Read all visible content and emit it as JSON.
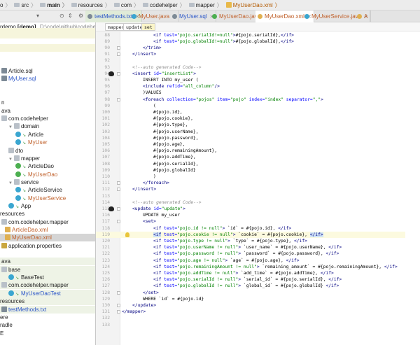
{
  "breadcrumb": [
    "o",
    "src",
    "main",
    "resources",
    "com",
    "codehelper",
    "mapper",
    "MyUserDao.xml"
  ],
  "project": {
    "root_name": "rdemo",
    "root_module": "[demo]",
    "root_path": "D:\\code\\github\\codehelper",
    "tree": [
      {
        "label": "Article.sql",
        "indent": 0,
        "icon": "txt",
        "color": "#222"
      },
      {
        "label": "MyUser.sql",
        "indent": 0,
        "icon": "txt",
        "color": "#2a55c8"
      },
      {
        "label": "",
        "indent": 0
      },
      {
        "label": "",
        "indent": 0
      },
      {
        "label": "n",
        "indent": 0
      },
      {
        "label": "ava",
        "indent": 0
      },
      {
        "label": "com.codehelper",
        "indent": 0,
        "icon": "folder"
      },
      {
        "label": "domain",
        "indent": 1,
        "icon": "folder",
        "arrow": "▼"
      },
      {
        "label": "Article",
        "indent": 2,
        "icon": "cls",
        "mod": true
      },
      {
        "label": "MyUser",
        "indent": 2,
        "icon": "cls",
        "mod": true,
        "color": "#c0602a"
      },
      {
        "label": "dto",
        "indent": 1,
        "icon": "folder"
      },
      {
        "label": "mapper",
        "indent": 1,
        "icon": "folder",
        "arrow": "▼"
      },
      {
        "label": "ArticleDao",
        "indent": 2,
        "icon": "intf",
        "mod": true
      },
      {
        "label": "MyUserDao",
        "indent": 2,
        "icon": "intf",
        "mod": true,
        "color": "#c0602a"
      },
      {
        "label": "service",
        "indent": 1,
        "icon": "folder",
        "arrow": "▼"
      },
      {
        "label": "ArticleService",
        "indent": 2,
        "icon": "cls",
        "mod": true
      },
      {
        "label": "MyUserService",
        "indent": 2,
        "icon": "cls",
        "mod": true,
        "color": "#c0602a"
      },
      {
        "label": "App",
        "indent": 1,
        "icon": "cls",
        "mod": true
      },
      {
        "label": "resources",
        "indent": -1
      },
      {
        "label": "com.codehelper.mapper",
        "indent": 0,
        "icon": "folder"
      },
      {
        "label": "ArticleDao.xml",
        "indent": 0.5,
        "icon": "xml",
        "color": "#c0602a"
      },
      {
        "label": "MyUserDao.xml",
        "indent": 0.5,
        "icon": "xml",
        "color": "#c0602a",
        "selected": true
      },
      {
        "label": "application.properties",
        "indent": 0,
        "icon": "props"
      },
      {
        "label": "",
        "indent": 0
      },
      {
        "label": "ava",
        "indent": 0,
        "test": true
      },
      {
        "label": "base",
        "indent": 0,
        "icon": "folder",
        "test": true
      },
      {
        "label": "BaseTest",
        "indent": 1,
        "icon": "cls",
        "mod": true,
        "test": true
      },
      {
        "label": "com.codehelper.mapper",
        "indent": 0,
        "icon": "folder",
        "test": true
      },
      {
        "label": "MyUserDaoTest",
        "indent": 1,
        "icon": "cls",
        "mod": true,
        "color": "#2a55c8",
        "test": true
      },
      {
        "label": "resources",
        "indent": -1,
        "test": true
      },
      {
        "label": "testMethods.txt",
        "indent": 0,
        "icon": "txt",
        "color": "#2a55c8",
        "test": true
      },
      {
        "label": "ere",
        "indent": -1
      },
      {
        "label": "radle",
        "indent": -1
      },
      {
        "label": "E",
        "indent": -1
      }
    ]
  },
  "tabs": [
    {
      "label": "testMethods.txt",
      "color": "#2a55c8",
      "icon": "#7d8a96"
    },
    {
      "label": "MyUser.java",
      "color": "#c0602a",
      "icon": "#3aa6d0"
    },
    {
      "label": "MyUser.sql",
      "color": "#2a55c8",
      "icon": "#7d8a96"
    },
    {
      "label": "MyUserDao.java",
      "color": "#c0602a",
      "icon": "#4caf50"
    },
    {
      "label": "MyUserDao.xml",
      "color": "#c0602a",
      "icon": "#e0b050",
      "active": true
    },
    {
      "label": "MyUserService.java",
      "color": "#c0602a",
      "icon": "#3aa6d0"
    },
    {
      "label": "A",
      "color": "#c0602a",
      "icon": "#e0b050"
    }
  ],
  "editor_breadcrumb": [
    "mapper",
    "update",
    "set"
  ],
  "code": {
    "start": 88,
    "highlight_line": 119,
    "lines": [
      [
        3,
        [
          [
            "t",
            "<if "
          ],
          [
            "a",
            "test="
          ],
          [
            "v",
            "\"pojo.serialId!=null\""
          ],
          [
            "t",
            ">"
          ],
          [
            "p",
            "#{pojo.serialId},"
          ],
          [
            "t",
            "</if>"
          ]
        ]
      ],
      [
        3,
        [
          [
            "t",
            "<if "
          ],
          [
            "a",
            "test="
          ],
          [
            "v",
            "\"pojo.globalId!=null\""
          ],
          [
            "t",
            ">"
          ],
          [
            "p",
            "#{pojo.globalId},"
          ],
          [
            "t",
            "</if>"
          ]
        ]
      ],
      [
        2,
        [
          [
            "t",
            "</trim>"
          ]
        ]
      ],
      [
        1,
        [
          [
            "t",
            "</insert>"
          ]
        ]
      ],
      [
        0,
        []
      ],
      [
        1,
        [
          [
            "c",
            "<!--auto generated Code-->"
          ]
        ]
      ],
      [
        1,
        [
          [
            "t",
            "<insert "
          ],
          [
            "a",
            "id="
          ],
          [
            "v",
            "\"insertList\""
          ],
          [
            "t",
            ">"
          ]
        ]
      ],
      [
        2,
        [
          [
            "p",
            "INSERT INTO my_user ("
          ]
        ]
      ],
      [
        2,
        [
          [
            "t",
            "<include "
          ],
          [
            "a",
            "refid="
          ],
          [
            "v",
            "\"all_column\""
          ],
          [
            "t",
            "/>"
          ]
        ]
      ],
      [
        2,
        [
          [
            "p",
            ")VALUES"
          ]
        ]
      ],
      [
        2,
        [
          [
            "t",
            "<foreach "
          ],
          [
            "a",
            "collection="
          ],
          [
            "v",
            "\"pojos\" "
          ],
          [
            "a",
            "item="
          ],
          [
            "v",
            "\"pojo\" "
          ],
          [
            "a",
            "index="
          ],
          [
            "v",
            "\"index\" "
          ],
          [
            "a",
            "separator="
          ],
          [
            "v",
            "\",\""
          ],
          [
            "t",
            ">"
          ]
        ]
      ],
      [
        3,
        [
          [
            "p",
            "("
          ]
        ]
      ],
      [
        3,
        [
          [
            "p",
            "#{pojo.id},"
          ]
        ]
      ],
      [
        3,
        [
          [
            "p",
            "#{pojo.cookie},"
          ]
        ]
      ],
      [
        3,
        [
          [
            "p",
            "#{pojo.type},"
          ]
        ]
      ],
      [
        3,
        [
          [
            "p",
            "#{pojo.userName},"
          ]
        ]
      ],
      [
        3,
        [
          [
            "p",
            "#{pojo.password},"
          ]
        ]
      ],
      [
        3,
        [
          [
            "p",
            "#{pojo.age},"
          ]
        ]
      ],
      [
        3,
        [
          [
            "p",
            "#{pojo.remainingAmount},"
          ]
        ]
      ],
      [
        3,
        [
          [
            "p",
            "#{pojo.addTime},"
          ]
        ]
      ],
      [
        3,
        [
          [
            "p",
            "#{pojo.serialId},"
          ]
        ]
      ],
      [
        3,
        [
          [
            "p",
            "#{pojo.globalId}"
          ]
        ]
      ],
      [
        3,
        [
          [
            "p",
            ")"
          ]
        ]
      ],
      [
        2,
        [
          [
            "t",
            "</foreach>"
          ]
        ]
      ],
      [
        1,
        [
          [
            "t",
            "</insert>"
          ]
        ]
      ],
      [
        0,
        []
      ],
      [
        1,
        [
          [
            "c",
            "<!--auto generated Code-->"
          ]
        ]
      ],
      [
        1,
        [
          [
            "t",
            "<update "
          ],
          [
            "a",
            "id="
          ],
          [
            "v",
            "\"update\""
          ],
          [
            "t",
            ">"
          ]
        ]
      ],
      [
        2,
        [
          [
            "p",
            "UPDATE my_user"
          ]
        ]
      ],
      [
        2,
        [
          [
            "t",
            "<set>"
          ]
        ]
      ],
      [
        3,
        [
          [
            "t",
            "<if "
          ],
          [
            "a",
            "test="
          ],
          [
            "v",
            "\"pojo.id != null\""
          ],
          [
            "t",
            ">"
          ],
          [
            "p",
            " `id` = #{pojo.id}, "
          ],
          [
            "t",
            "</if>"
          ]
        ]
      ],
      [
        3,
        [
          [
            "tsel t",
            "<if"
          ],
          [
            "a",
            " test="
          ],
          [
            "v",
            "\"pojo.cookie != null\""
          ],
          [
            "t",
            ">"
          ],
          [
            "p",
            " `cookie` = #{pojo.cookie}, "
          ],
          [
            "tsel t",
            "</if>"
          ]
        ]
      ],
      [
        3,
        [
          [
            "t",
            "<if "
          ],
          [
            "a",
            "test="
          ],
          [
            "v",
            "\"pojo.type != null\""
          ],
          [
            "t",
            ">"
          ],
          [
            "p",
            " `type` = #{pojo.type}, "
          ],
          [
            "t",
            "</if>"
          ]
        ]
      ],
      [
        3,
        [
          [
            "t",
            "<if "
          ],
          [
            "a",
            "test="
          ],
          [
            "v",
            "\"pojo.userName != null\""
          ],
          [
            "t",
            ">"
          ],
          [
            "p",
            " `user_name` = #{pojo.userName}, "
          ],
          [
            "t",
            "</if>"
          ]
        ]
      ],
      [
        3,
        [
          [
            "t",
            "<if "
          ],
          [
            "a",
            "test="
          ],
          [
            "v",
            "\"pojo.password != null\""
          ],
          [
            "t",
            ">"
          ],
          [
            "p",
            " `password` = #{pojo.password}, "
          ],
          [
            "t",
            "</if>"
          ]
        ]
      ],
      [
        3,
        [
          [
            "t",
            "<if "
          ],
          [
            "a",
            "test="
          ],
          [
            "v",
            "\"pojo.age != null\""
          ],
          [
            "t",
            ">"
          ],
          [
            "p",
            " `age` = #{pojo.age}, "
          ],
          [
            "t",
            "</if>"
          ]
        ]
      ],
      [
        3,
        [
          [
            "t",
            "<if "
          ],
          [
            "a",
            "test="
          ],
          [
            "v",
            "\"pojo.remainingAmount != null\""
          ],
          [
            "t",
            ">"
          ],
          [
            "p",
            " `remaining_amount` = #{pojo.remainingAmount}, "
          ],
          [
            "t",
            "</if>"
          ]
        ]
      ],
      [
        3,
        [
          [
            "t",
            "<if "
          ],
          [
            "a",
            "test="
          ],
          [
            "v",
            "\"pojo.addTime != null\""
          ],
          [
            "t",
            ">"
          ],
          [
            "p",
            " `add_time` = #{pojo.addTime}, "
          ],
          [
            "t",
            "</if>"
          ]
        ]
      ],
      [
        3,
        [
          [
            "t",
            "<if "
          ],
          [
            "a",
            "test="
          ],
          [
            "v",
            "\"pojo.serialId != null\""
          ],
          [
            "t",
            ">"
          ],
          [
            "p",
            " `serial_id` = #{pojo.serialId}, "
          ],
          [
            "t",
            "</if>"
          ]
        ]
      ],
      [
        3,
        [
          [
            "t",
            "<if "
          ],
          [
            "a",
            "test="
          ],
          [
            "v",
            "\"pojo.globalId != null\""
          ],
          [
            "t",
            ">"
          ],
          [
            "p",
            " `global_id` = #{pojo.globalId} "
          ],
          [
            "t",
            "</if>"
          ]
        ]
      ],
      [
        2,
        [
          [
            "t",
            "</set>"
          ]
        ]
      ],
      [
        2,
        [
          [
            "p",
            "WHERE `id` = #{pojo.id}"
          ]
        ]
      ],
      [
        1,
        [
          [
            "t",
            "</update>"
          ]
        ]
      ],
      [
        0,
        [
          [
            "t",
            "</mapper>"
          ]
        ]
      ],
      [
        0,
        []
      ],
      [
        0,
        []
      ]
    ]
  },
  "colors": {
    "tag": "#000080",
    "attr": "#0000ff",
    "value": "#008000",
    "comment": "#8c8c8c",
    "highlight": "#fcfadf"
  }
}
